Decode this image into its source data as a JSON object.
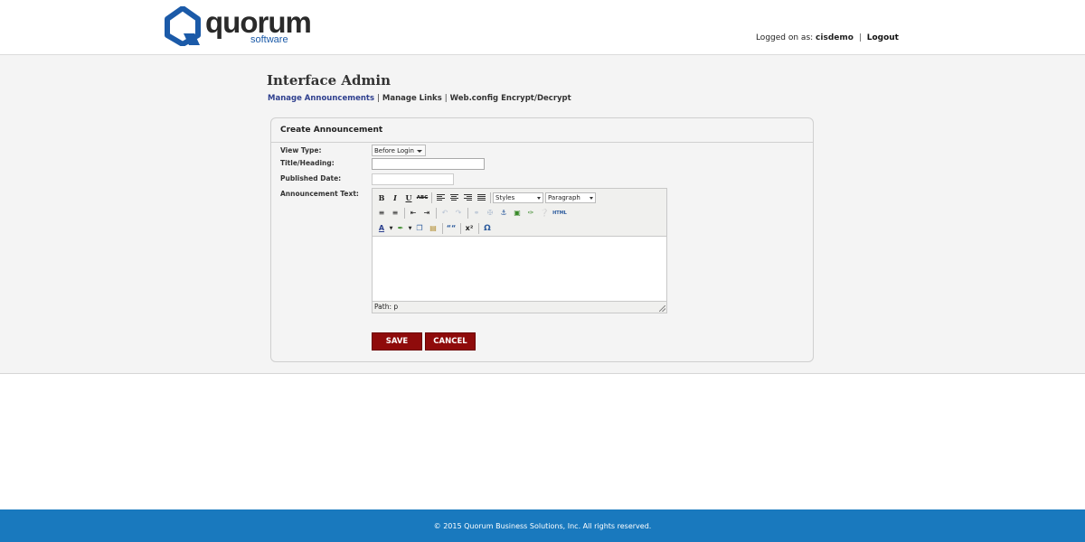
{
  "brand": {
    "name": "quorum",
    "tagline": "software",
    "color": "#1b5aa8"
  },
  "header": {
    "logged_on_label": "Logged on as:",
    "username": "cisdemo",
    "separator": "|",
    "logout_label": "Logout"
  },
  "page": {
    "title": "Interface Admin"
  },
  "subnav": {
    "items": [
      "Manage Announcements",
      "Manage Links",
      "Web.config Encrypt/Decrypt"
    ],
    "separator": "|"
  },
  "form": {
    "heading": "Create Announcement",
    "view_type_label": "View Type:",
    "view_type_value": "Before Login",
    "title_label": "Title/Heading:",
    "title_value": "",
    "published_label": "Published Date:",
    "published_value": "",
    "text_label": "Announcement Text:",
    "save_label": "SAVE",
    "cancel_label": "CANCEL",
    "button_color": "#8f0b0b"
  },
  "editor": {
    "styles_label": "Styles",
    "format_label": "Paragraph",
    "path_label": "Path: p",
    "toolbar_text": {
      "bold": "B",
      "italic": "I",
      "underline": "U",
      "strike": "ABC",
      "blockquote": "““",
      "superscript": "x²",
      "charmap": "Ω",
      "html": "HTML"
    }
  },
  "footer": {
    "text": "© 2015 Quorum Business Solutions, Inc. All rights reserved.",
    "color": "#1979be"
  }
}
